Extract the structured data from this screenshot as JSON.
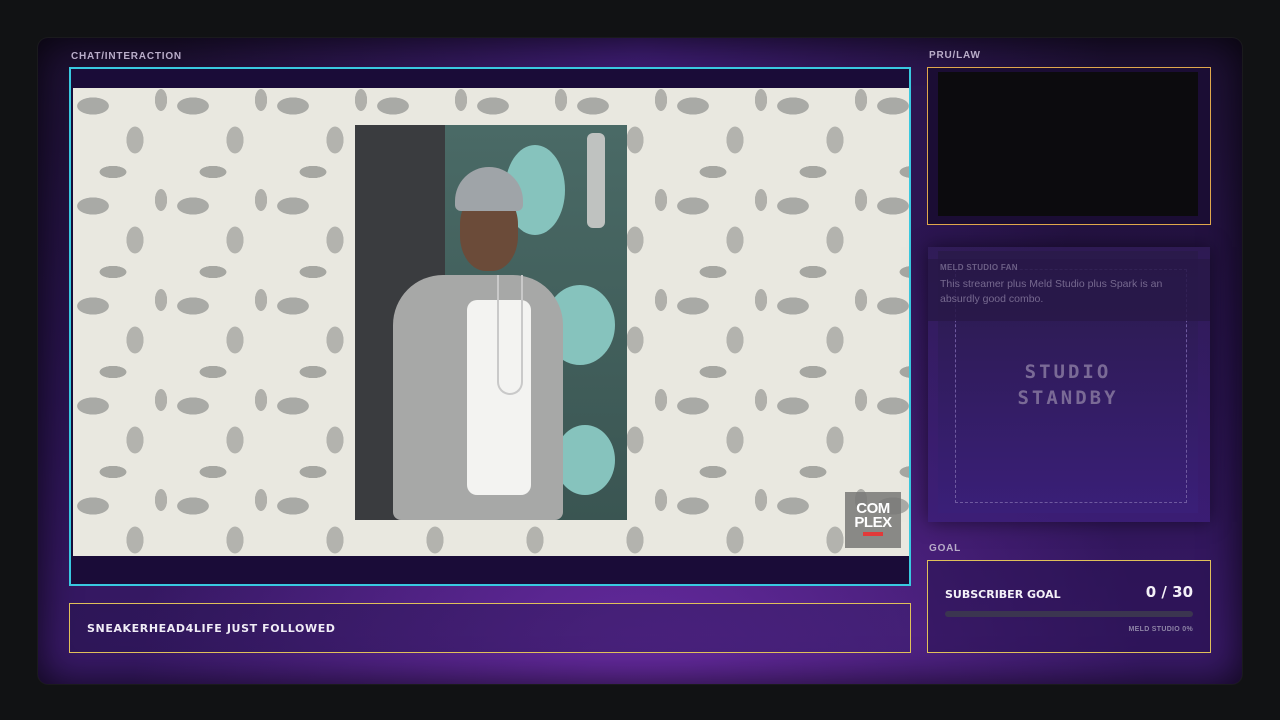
{
  "labels": {
    "chat": "CHAT/INTERACTION",
    "pru": "PRU/LAW",
    "goal": "GOAL"
  },
  "video": {
    "logo_line1": "COM",
    "logo_line2": "PLEX"
  },
  "chat_card": {
    "user": "MELD STUDIO FAN",
    "message": "This streamer plus Meld Studio plus Spark is an absurdly good combo."
  },
  "standby": {
    "line1": "STUDIO",
    "line2": "STANDBY"
  },
  "alert": {
    "text": "SNEAKERHEAD4LIFE JUST FOLLOWED"
  },
  "goal": {
    "title": "SUBSCRIBER GOAL",
    "count": "0 / 30",
    "current": 0,
    "target": 30,
    "meta": "MELD STUDIO 0%"
  },
  "colors": {
    "video_border": "#39c9e0",
    "accent_border": "#e0c05a",
    "pru_border": "#e0a84c",
    "goal_fill": "#b58cff"
  }
}
